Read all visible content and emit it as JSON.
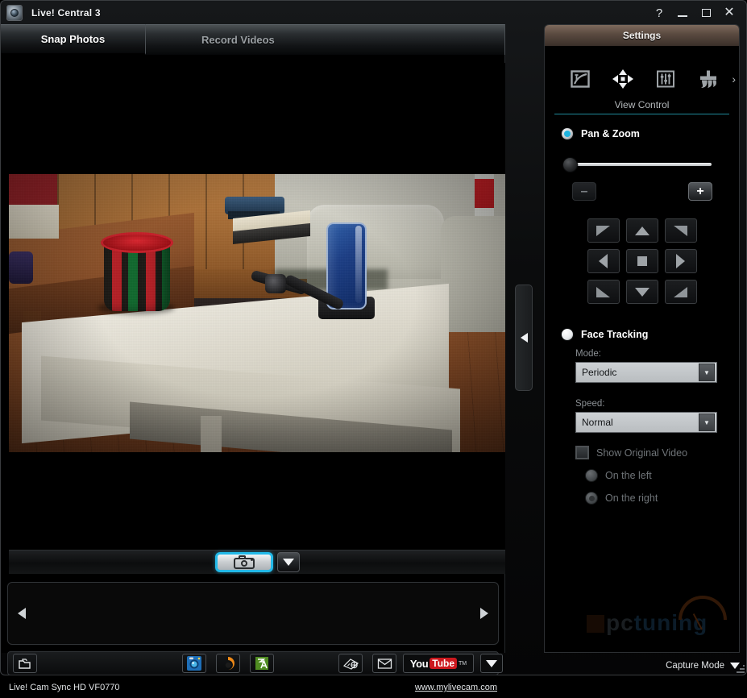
{
  "window": {
    "title": "Live! Central 3",
    "app_icon": "webcam-lens-icon",
    "buttons": {
      "help": "?",
      "minimize": "minimize-icon",
      "maximize": "maximize-icon",
      "close": "✕"
    }
  },
  "tabs": [
    {
      "label": "Snap Photos",
      "active": true
    },
    {
      "label": "Record Videos",
      "active": false
    }
  ],
  "video": {
    "scene_description": "Live webcam preview: plaid red and green cup and a blue phone on a dock sitting on a white coffee table, beige sofa and wood panel wall in the background"
  },
  "capture_bar": {
    "snap_button_icon": "camera-icon",
    "snap_dropdown_icon": "chevron-down-icon",
    "accent_color": "#23b9e8"
  },
  "filmstrip": {
    "prev_icon": "triangle-left-icon",
    "next_icon": "triangle-right-icon",
    "items": []
  },
  "bottom_toolbar": {
    "folder_label": "folder-icon",
    "middle_buttons": [
      {
        "name": "webcam-center-icon"
      },
      {
        "name": "creative-orb-icon"
      },
      {
        "name": "photo-album-icon"
      }
    ],
    "right_buttons": [
      {
        "name": "film-reel-icon"
      },
      {
        "name": "email-icon"
      }
    ],
    "youtube": {
      "you": "You",
      "tube": "Tube",
      "tm": "TM"
    },
    "youtube_dropdown_icon": "triangle-down-icon"
  },
  "statusbar": {
    "device": "Live! Cam Sync HD VF0770",
    "link": "www.mylivecam.com"
  },
  "collapse_handle": {
    "icon": "triangle-left-icon"
  },
  "settings": {
    "header": "Settings",
    "toolbar_icons": [
      {
        "name": "image-effects-icon",
        "selected": false
      },
      {
        "name": "pan-tilt-icon",
        "selected": true
      },
      {
        "name": "adjustments-sliders-icon",
        "selected": false
      },
      {
        "name": "brush-icon",
        "selected": false
      }
    ],
    "more_icon": "chevron-right-icon",
    "section_title": "View Control",
    "section_rule_color": "#1f8a99",
    "pan_zoom": {
      "label": "Pan & Zoom",
      "selected": true,
      "zoom_out_label": "–",
      "zoom_in_label": "+",
      "slider_position_percent": 0,
      "dpad": [
        {
          "name": "pan-up-left-button",
          "icon": "triangle-nw-icon"
        },
        {
          "name": "pan-up-button",
          "icon": "triangle-up-icon"
        },
        {
          "name": "pan-up-right-button",
          "icon": "triangle-ne-icon"
        },
        {
          "name": "pan-left-button",
          "icon": "triangle-left-icon"
        },
        {
          "name": "pan-center-button",
          "icon": "square-stop-icon"
        },
        {
          "name": "pan-right-button",
          "icon": "triangle-right-icon"
        },
        {
          "name": "pan-down-left-button",
          "icon": "triangle-sw-icon"
        },
        {
          "name": "pan-down-button",
          "icon": "triangle-down-icon"
        },
        {
          "name": "pan-down-right-button",
          "icon": "triangle-se-icon"
        }
      ]
    },
    "face_tracking": {
      "label": "Face Tracking",
      "selected": false,
      "mode_label": "Mode:",
      "mode_value": "Periodic",
      "speed_label": "Speed:",
      "speed_value": "Normal",
      "show_original_label": "Show Original Video",
      "show_original_checked": false,
      "position_options": [
        {
          "label": "On the left",
          "selected": false
        },
        {
          "label": "On the right",
          "selected": true
        }
      ],
      "dropdown_arrow_icon": "triangle-down-icon"
    },
    "watermark": {
      "part1": "pc",
      "part2": "tuning"
    },
    "capture_mode": {
      "label": "Capture Mode",
      "icon": "triangle-down-icon"
    }
  }
}
